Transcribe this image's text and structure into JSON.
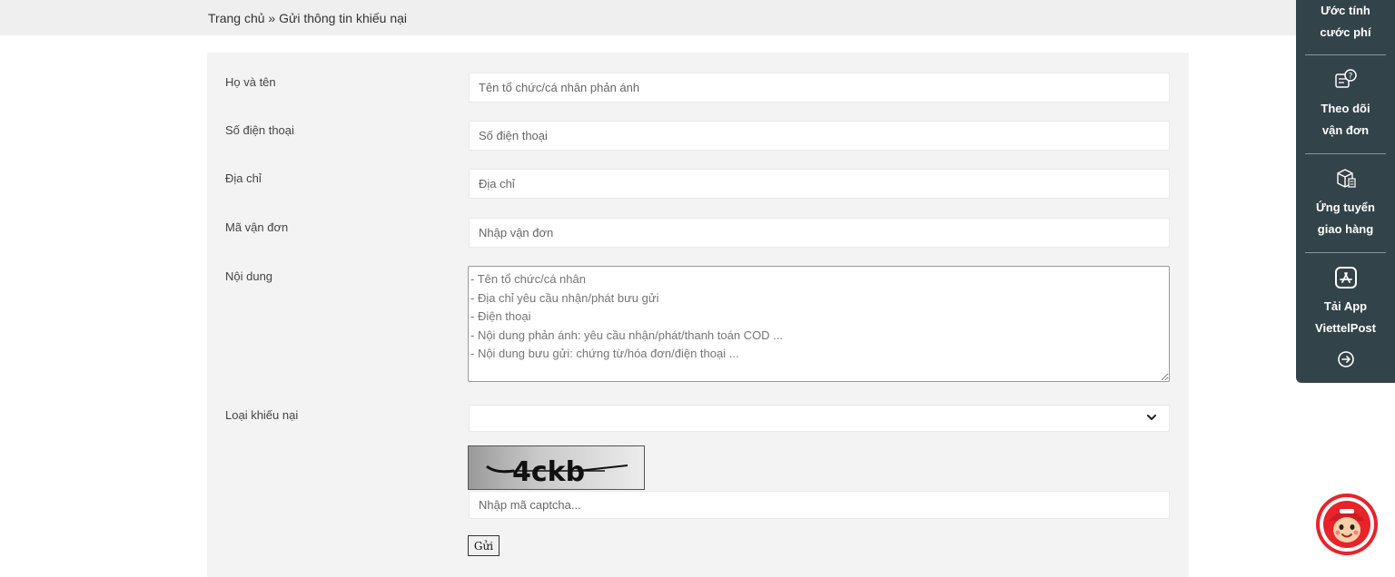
{
  "breadcrumb": {
    "home": "Trang chủ",
    "separator": "»",
    "current": "Gửi thông tin khiếu nại"
  },
  "form": {
    "fields": [
      {
        "label": "Họ và tên",
        "placeholder": "Tên tổ chức/cá nhân phản ánh",
        "value": ""
      },
      {
        "label": "Số điện thoại",
        "placeholder": "Số điện thoại",
        "value": ""
      },
      {
        "label": "Địa chỉ",
        "placeholder": "Địa chỉ",
        "value": ""
      },
      {
        "label": "Mã vận đơn",
        "placeholder": "Nhập vận đơn",
        "value": ""
      }
    ],
    "content": {
      "label": "Nội dung",
      "placeholder": "- Tên tổ chức/cá nhân\n- Địa chỉ yêu cầu nhận/phát bưu gửi\n- Điện thoại\n- Nội dung phản ánh: yêu cầu nhận/phát/thanh toán COD ...\n- Nội dung bưu gửi: chứng từ/hóa đơn/điện thoại ..."
    },
    "complaint_type": {
      "label": "Loại khiếu nại",
      "selected": ""
    },
    "captcha": {
      "image_text": "4ckb",
      "placeholder": "Nhập mã captcha..."
    },
    "submit_label": "Gửi"
  },
  "side_panel": {
    "items": [
      {
        "label_line1": "Ước tính",
        "label_line2": "cước phí",
        "icon": "calculator-icon"
      },
      {
        "label_line1": "Theo dõi",
        "label_line2": "vận đơn",
        "icon": "document-question-icon"
      },
      {
        "label_line1": "Ứng tuyển",
        "label_line2": "giao hàng",
        "icon": "package-icon"
      },
      {
        "label_line1": "Tải App",
        "label_line2": "ViettelPost",
        "icon": "app-store-icon"
      }
    ],
    "collapse_icon": "arrow-right-circle-icon"
  },
  "mascot": {
    "icon": "viettelpost-mascot-icon"
  },
  "colors": {
    "breadcrumb_bg": "#efefef",
    "form_bg": "#f3f3f3",
    "side_panel_bg": "#33434a",
    "mascot_red": "#e8232a"
  }
}
